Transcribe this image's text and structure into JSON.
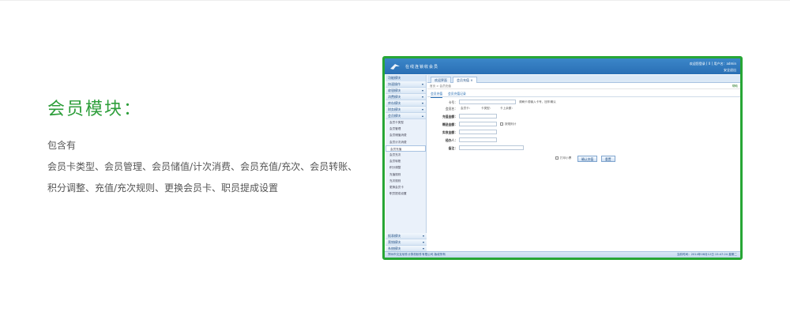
{
  "promo": {
    "title": "会员模块：",
    "subtitle": "包含有",
    "description": "会员卡类型、会员管理、会员储值/计次消费、会员充值/充次、会员转账、积分调整、充值/充次规则、更换会员卡、职员提成设置"
  },
  "screenshot": {
    "app_title": "在线连锁收会员",
    "header_user": "欢迎您登录 [ 0 ] 用户名：admin",
    "header_link": "安全退出",
    "sidebar": {
      "title": "功能模块",
      "groups_top": [
        "快速操作",
        "收银模块",
        "消费模块",
        "库存模块",
        "财务模块",
        "会员模块"
      ],
      "items": [
        "会员卡类型",
        "会员管理",
        "会员储值消费",
        "会员计次消费",
        "会员充值",
        "会员充次",
        "会员转账",
        "积分调整",
        "充值规则",
        "充次规则",
        "更换会员卡",
        "职员提成设置"
      ],
      "active_item": "会员充值",
      "groups_bottom": [
        "报表模块",
        "营销模块",
        "系统模块"
      ]
    },
    "tabs": [
      "欢迎界面",
      "会员充值"
    ],
    "breadcrumb": "首页 > 会员充值",
    "help": "帮助",
    "subtabs": [
      "会员充值",
      "会员充值记录"
    ],
    "form": {
      "card_label": "卡号：",
      "card_hint": "请刷卡或输入卡号，回车确认",
      "member_label": "会员名：",
      "member_card": "会员卡：",
      "card_type": "卡类型：",
      "points": "卡上余额：",
      "amount_label": "充值金额：",
      "gift_label": "赠送金额：",
      "gift_check": "按规则计",
      "paid_label": "实收金额：",
      "staff_label": "经办人：",
      "remark_label": "备注：",
      "print_label": "打印小票",
      "confirm_button": "确认充值",
      "reset_button": "重置"
    },
    "footer_left": "郑州市文友软件计算机软件有限公司 版权所有",
    "footer_right": "当前时间：2014年08月12日 15:47:24 星期二"
  }
}
